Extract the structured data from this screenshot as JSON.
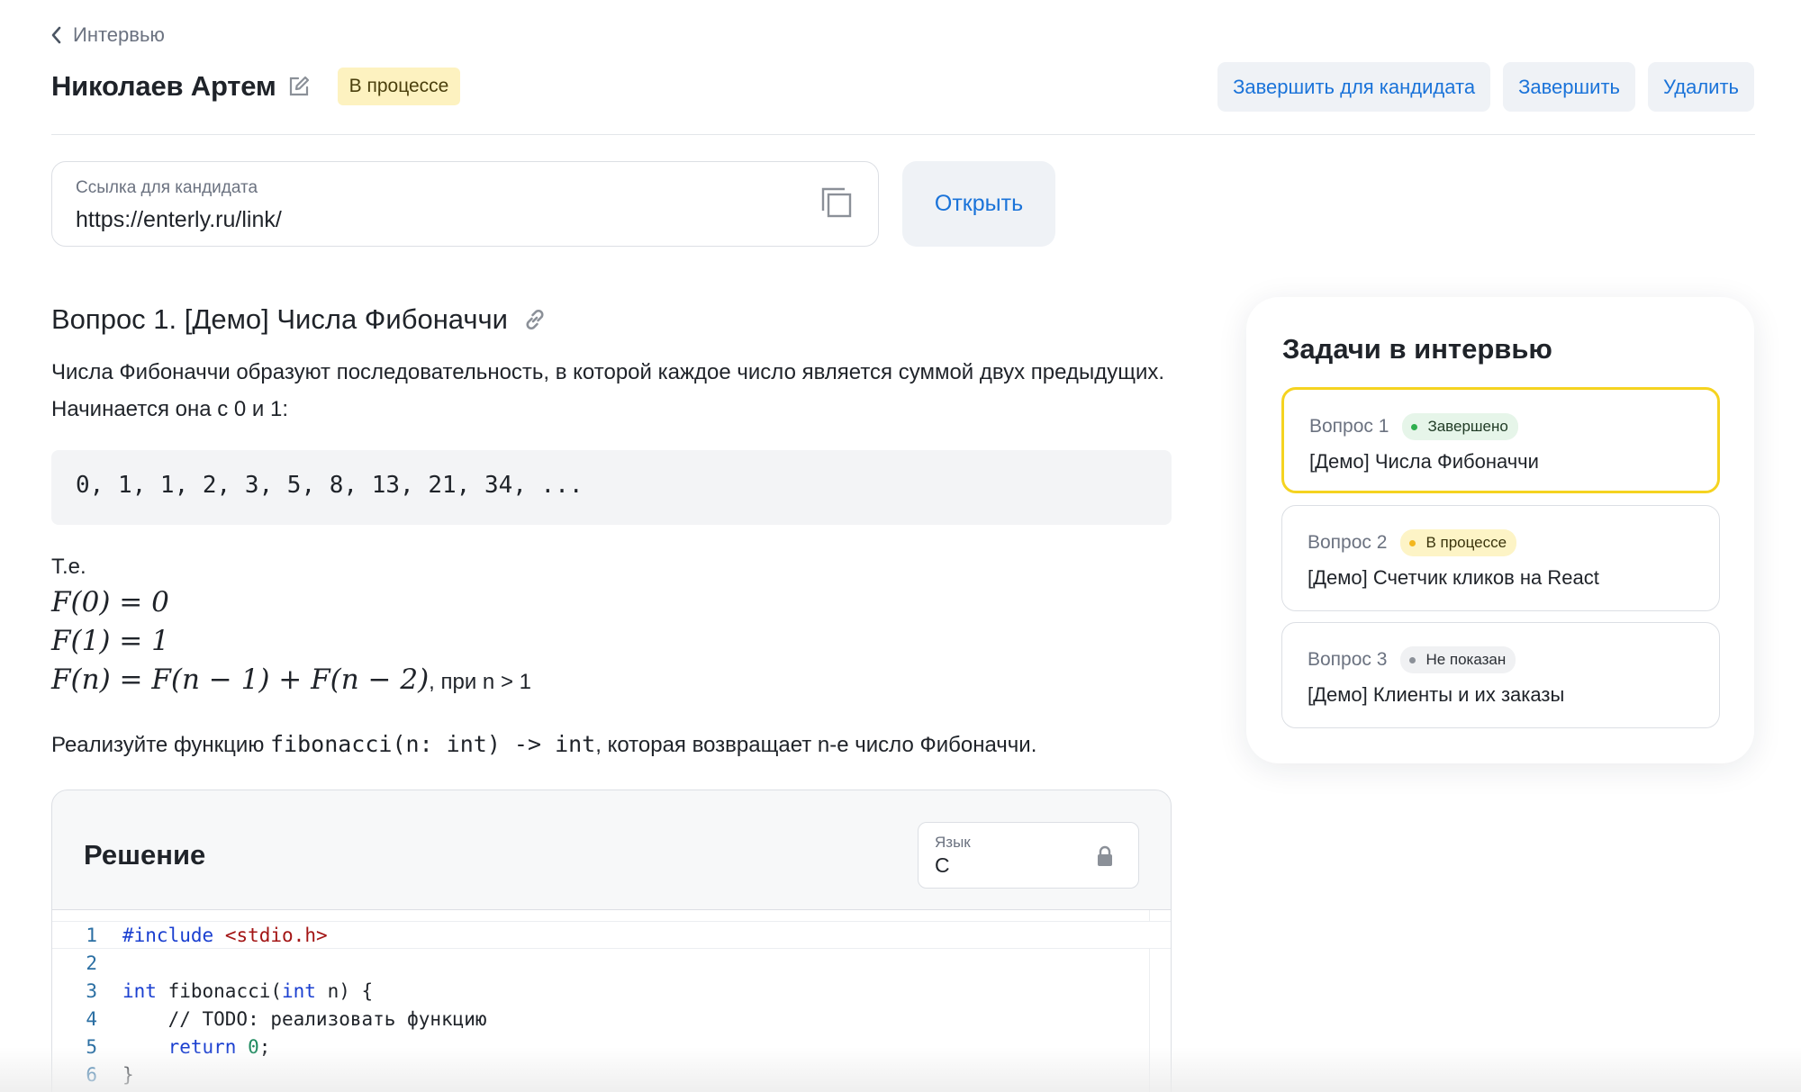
{
  "breadcrumb": {
    "back_label": "Интервью"
  },
  "header": {
    "candidate_name": "Николаев Артем",
    "status": "В процессе",
    "actions": {
      "finish_for_candidate": "Завершить для кандидата",
      "finish": "Завершить",
      "delete": "Удалить"
    }
  },
  "candidate_link": {
    "label": "Ссылка для кандидата",
    "value": "https://enterly.ru/link/",
    "open_label": "Открыть"
  },
  "question": {
    "title": "Вопрос 1. [Демо] Числа Фибоначчи",
    "description": "Числа Фибоначчи образуют последовательность, в которой каждое число является суммой двух предыдущих. Начинается она с 0 и 1:",
    "sequence": "0, 1, 1, 2, 3, 5, 8, 13, 21, 34, ...",
    "te": "Т.е.",
    "formulas": {
      "f0": "F(0) = 0",
      "f1": "F(1) = 1",
      "fn": "F(n) = F(n − 1) + F(n − 2)",
      "fn_tail": ", при n > 1"
    },
    "task_prefix": "Реализуйте функцию ",
    "task_signature": "fibonacci(n: int) -> int",
    "task_suffix": ", которая возвращает n-е число Фибоначчи."
  },
  "solution": {
    "title": "Решение",
    "language_label": "Язык",
    "language_value": "C",
    "code_lines": [
      {
        "n": "1",
        "text": "#include <stdio.h>"
      },
      {
        "n": "2",
        "text": ""
      },
      {
        "n": "3",
        "text": "int fibonacci(int n) {"
      },
      {
        "n": "4",
        "text": "    // TODO: реализовать функцию"
      },
      {
        "n": "5",
        "text": "    return 0;"
      },
      {
        "n": "6",
        "text": "}"
      }
    ]
  },
  "tasks_panel": {
    "title": "Задачи в интервью",
    "items": [
      {
        "number": "Вопрос 1",
        "status": "Завершено",
        "status_kind": "done",
        "title": "[Демо] Числа Фибоначчи",
        "selected": true
      },
      {
        "number": "Вопрос 2",
        "status": "В процессе",
        "status_kind": "progress",
        "title": "[Демо] Счетчик кликов на React",
        "selected": false
      },
      {
        "number": "Вопрос 3",
        "status": "Не показан",
        "status_kind": "hidden",
        "title": "[Демо] Клиенты и их заказы",
        "selected": false
      }
    ]
  },
  "colors": {
    "accent": "#1a73d9",
    "status_yellow_bg": "#fdf2c0",
    "selected_border": "#f5d320",
    "done_dot": "#2fae4e",
    "progress_dot": "#f3b71e",
    "hidden_dot": "#8b9098"
  },
  "icons": {
    "back": "chevron-left-icon",
    "edit": "edit-icon",
    "copy": "copy-icon",
    "link": "link-icon",
    "lock": "lock-icon"
  }
}
